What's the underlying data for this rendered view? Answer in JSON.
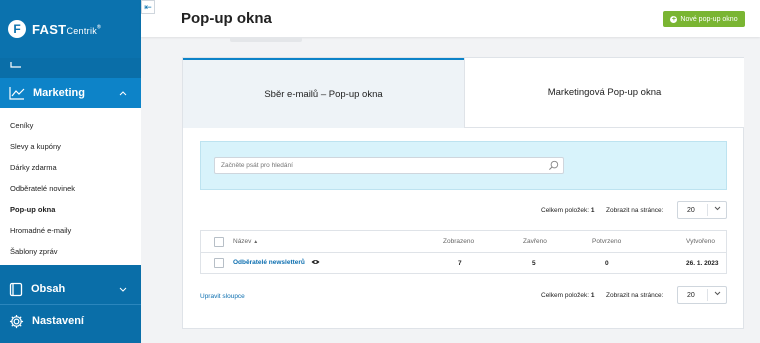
{
  "brand": {
    "letter": "F",
    "name_bold": "FAST",
    "name_thin": "Centrik",
    "reg": "®"
  },
  "sidebar": {
    "collapse_glyph": "⇤",
    "marketing_label": "Marketing",
    "items": [
      {
        "label": "Ceníky"
      },
      {
        "label": "Slevy a kupóny"
      },
      {
        "label": "Dárky zdarma"
      },
      {
        "label": "Odběratelé novinek"
      },
      {
        "label": "Pop-up okna"
      },
      {
        "label": "Hromadné e-maily"
      },
      {
        "label": "Šablony zpráv"
      }
    ],
    "content_label": "Obsah",
    "settings_label": "Nastavení"
  },
  "header": {
    "title": "Pop-up okna",
    "new_button": "Nové pop-up okno"
  },
  "tabs": [
    {
      "label": "Sběr e-mailů – Pop-up okna"
    },
    {
      "label": "Marketingová Pop-up okna"
    }
  ],
  "search": {
    "placeholder": "Začněte psát pro hledání"
  },
  "pager": {
    "total_label": "Celkem položek:",
    "total_value": "1",
    "show_label": "Zobrazit na stránce:",
    "per_page": "20"
  },
  "table": {
    "columns": [
      "Název",
      "Zobrazeno",
      "Zavřeno",
      "Potvrzeno",
      "Vytvořeno"
    ],
    "rows": [
      {
        "name": "Odběratelé newsletterů",
        "shown": "7",
        "closed": "5",
        "confirmed": "0",
        "created": "26. 1. 2023"
      }
    ]
  },
  "footer": {
    "edit_columns": "Upravit sloupce"
  },
  "colors": {
    "sidebar": "#0a6ea8",
    "active_menu": "#0d83c8",
    "accent_green": "#7ab532",
    "link": "#0d6fb0"
  }
}
